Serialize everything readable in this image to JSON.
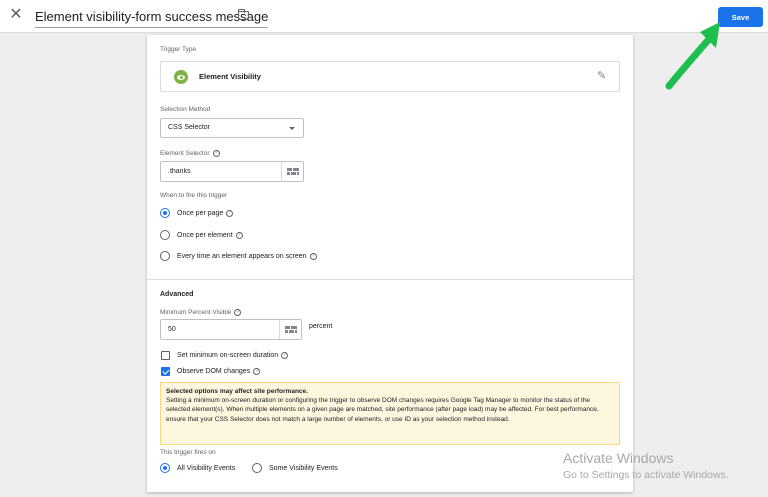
{
  "header": {
    "title": "Element visibility-form success message",
    "save_label": "Save"
  },
  "trigger_type": {
    "label": "Trigger Type",
    "name": "Element Visibility",
    "icon_color": "#7cb342"
  },
  "selection_method": {
    "label": "Selection Method",
    "value": "CSS Selector"
  },
  "element_selector": {
    "label": "Element Selector",
    "value": ".thanks"
  },
  "when_to_fire": {
    "label": "When to fire this trigger",
    "options": [
      {
        "label": "Once per page",
        "selected": true
      },
      {
        "label": "Once per element",
        "selected": false
      },
      {
        "label": "Every time an element appears on screen",
        "selected": false
      }
    ]
  },
  "advanced": {
    "title": "Advanced",
    "min_percent_label": "Minimum Percent Visible",
    "min_percent_value": "50",
    "min_percent_unit": "percent",
    "set_min_duration_label": "Set minimum on-screen duration",
    "set_min_duration_checked": false,
    "observe_dom_label": "Observe DOM changes",
    "observe_dom_checked": true
  },
  "warning": {
    "heading": "Selected options may affect site performance.",
    "body": "Setting a minimum on-screen duration or configuring the trigger to observe DOM changes requires Google Tag Manager to monitor the status of the selected element(s). When multiple elements on a given page are matched, site performance (after page load) may be affected. For best performance, ensure that your CSS Selector does not match a large number of elements, or use ID as your selection method instead."
  },
  "fires_on": {
    "label": "This trigger fires on",
    "options": [
      {
        "label": "All Visibility Events",
        "selected": true
      },
      {
        "label": "Some Visibility Events",
        "selected": false
      }
    ]
  },
  "watermark": {
    "line1": "Activate Windows",
    "line2": "Go to Settings to activate Windows."
  },
  "colors": {
    "accent": "#1a73e8",
    "annotation_arrow": "#1fbf4f",
    "warning_bg": "#fef7e0"
  }
}
